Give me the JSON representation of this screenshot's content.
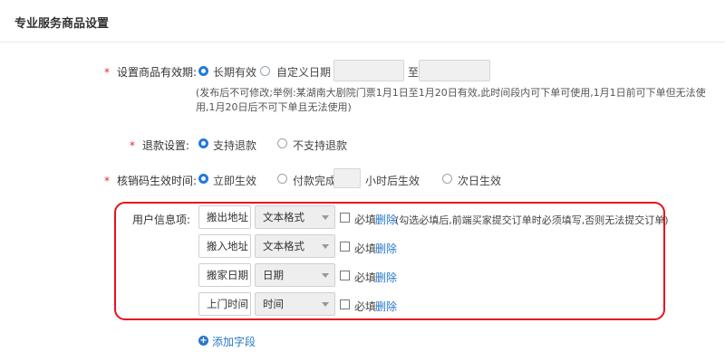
{
  "page": {
    "title": "专业服务商品设置"
  },
  "validity": {
    "required_mark": "*",
    "label": "设置商品有效期:",
    "option_long": "长期有效",
    "option_custom": "自定义日期",
    "to": "至",
    "note": "(发布后不可修改;举例:某湖南大剧院门票1月1日至1月20日有效,此时间段内可下单可使用,1月1日前可下单但无法使用,1月20日后不可下单且无法使用)"
  },
  "refund": {
    "required_mark": "*",
    "label": "退款设置:",
    "option_yes": "支持退款",
    "option_no": "不支持退款"
  },
  "verify": {
    "required_mark": "*",
    "label": "核销码生效时间:",
    "option_now": "立即生效",
    "option_after_pay": "付款完成",
    "hours_suffix": "小时后生效",
    "option_next_day": "次日生效"
  },
  "user_info": {
    "label": "用户信息项:",
    "rows": [
      {
        "name": "搬出地址",
        "type": "文本格式",
        "required_label": "必填",
        "delete": "删除",
        "hint": "(勾选必填后,前端买家提交订单时必须填写,否则无法提交订单)"
      },
      {
        "name": "搬入地址",
        "type": "文本格式",
        "required_label": "必填",
        "delete": "删除"
      },
      {
        "name": "搬家日期",
        "type": "日期",
        "required_label": "必填",
        "delete": "删除"
      },
      {
        "name": "上门时间",
        "type": "时间",
        "required_label": "必填",
        "delete": "删除"
      }
    ],
    "add_field": "添加字段",
    "add_icon": "plus-circle-icon"
  },
  "colors": {
    "accent": "#1f7bdb",
    "link": "#2a77c9",
    "required": "#e8262d",
    "highlight": "#e5121e"
  }
}
